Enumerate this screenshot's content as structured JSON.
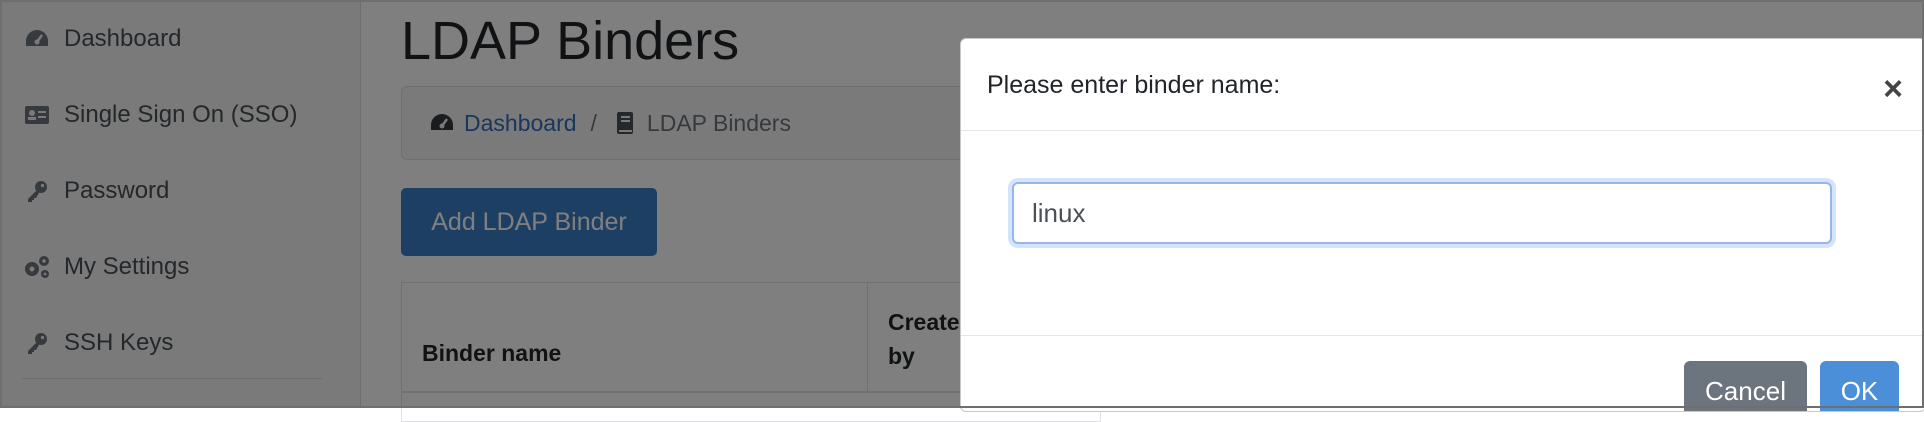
{
  "sidebar": {
    "items": [
      {
        "label": "Dashboard",
        "icon": "dashboard-gauge-icon"
      },
      {
        "label": "Single Sign On (SSO)",
        "icon": "id-card-icon"
      },
      {
        "label": "Password",
        "icon": "key-icon"
      },
      {
        "label": "My Settings",
        "icon": "gears-icon"
      },
      {
        "label": "SSH Keys",
        "icon": "key-icon"
      }
    ]
  },
  "main": {
    "title": "LDAP Binders",
    "breadcrumb": {
      "home": "Dashboard",
      "separator": "/",
      "current": "LDAP Binders"
    },
    "add_button": "Add LDAP Binder",
    "table": {
      "headers": [
        "Binder name",
        "Created by"
      ]
    }
  },
  "modal": {
    "title": "Please enter binder name:",
    "close_glyph": "×",
    "input_value": "linux",
    "cancel_label": "Cancel",
    "ok_label": "OK"
  },
  "colors": {
    "primary": "#3d7fc9",
    "ok_button": "#4a8fd8",
    "secondary": "#6c757d",
    "link": "#2f6eba",
    "overlay": "rgba(0,0,0,0.5)"
  }
}
